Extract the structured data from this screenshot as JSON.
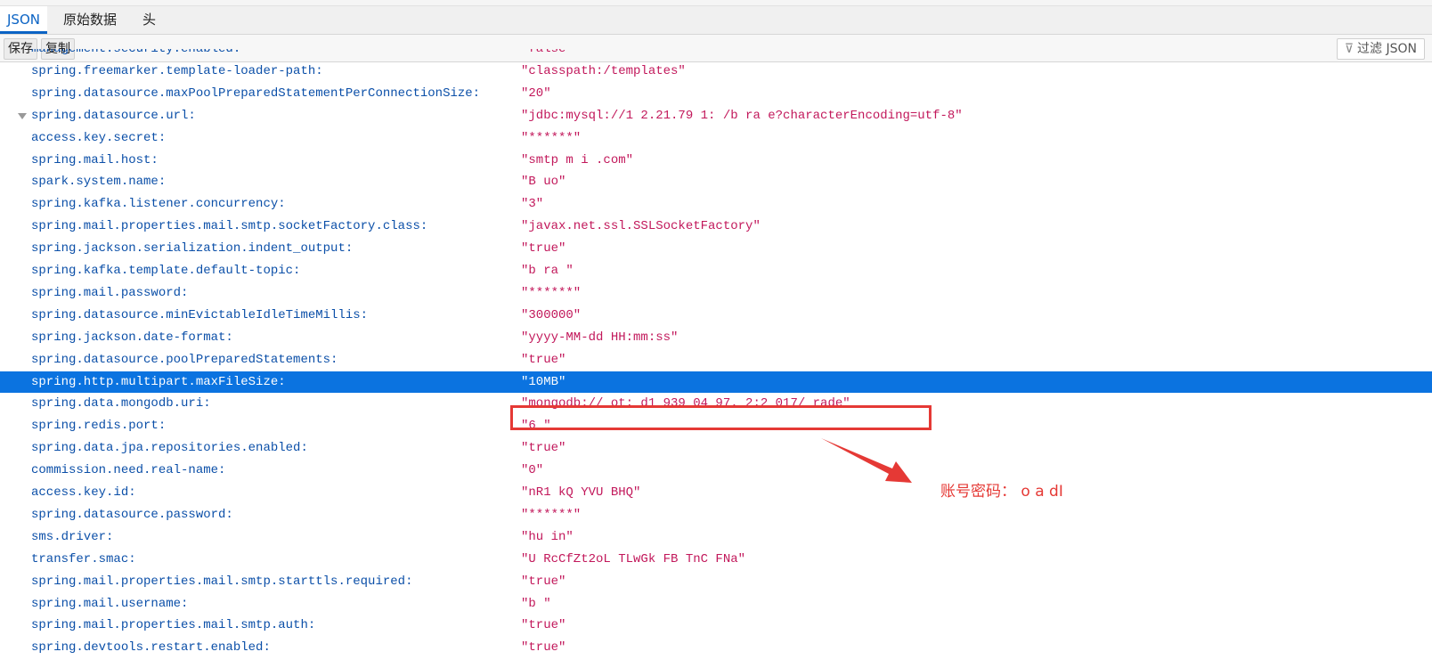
{
  "tabs": [
    {
      "label": "JSON",
      "active": true
    },
    {
      "label": "原始数据",
      "active": false
    },
    {
      "label": "头",
      "active": false
    }
  ],
  "toolbar": {
    "save_label": "保存",
    "copy_label": "复制",
    "filter_label": "过滤 JSON"
  },
  "rows": [
    {
      "key": "management.security.enabled:",
      "value": "\"false\""
    },
    {
      "key": "spring.freemarker.template-loader-path:",
      "value": "\"classpath:/templates\""
    },
    {
      "key": "spring.datasource.maxPoolPreparedStatementPerConnectionSize:",
      "value": "\"20\""
    },
    {
      "key": "spring.datasource.url:",
      "value": "\"jdbc:mysql://1 2.21.79 1:   /b  ra e?characterEncoding=utf-8\"",
      "expandable": true
    },
    {
      "key": "access.key.secret:",
      "value": "\"******\""
    },
    {
      "key": "spring.mail.host:",
      "value": "\"smtp  m  i .com\""
    },
    {
      "key": "spark.system.name:",
      "value": "\"B  uo\""
    },
    {
      "key": "spring.kafka.listener.concurrency:",
      "value": "\"3\""
    },
    {
      "key": "spring.mail.properties.mail.smtp.socketFactory.class:",
      "value": "\"javax.net.ssl.SSLSocketFactory\""
    },
    {
      "key": "spring.jackson.serialization.indent_output:",
      "value": "\"true\""
    },
    {
      "key": "spring.kafka.template.default-topic:",
      "value": "\"b  ra \""
    },
    {
      "key": "spring.mail.password:",
      "value": "\"******\""
    },
    {
      "key": "spring.datasource.minEvictableIdleTimeMillis:",
      "value": "\"300000\""
    },
    {
      "key": "spring.jackson.date-format:",
      "value": "\"yyyy-MM-dd HH:mm:ss\""
    },
    {
      "key": "spring.datasource.poolPreparedStatements:",
      "value": "\"true\""
    },
    {
      "key": "spring.http.multipart.maxFileSize:",
      "value": "\"10MB\"",
      "selected": true
    },
    {
      "key": "spring.data.mongodb.uri:",
      "value": "\"mongodb://  ot:  d1  939  04 97.  2:2 017/  rade\"",
      "highlighted": true
    },
    {
      "key": "spring.redis.port:",
      "value": "\"6  \""
    },
    {
      "key": "spring.data.jpa.repositories.enabled:",
      "value": "\"true\""
    },
    {
      "key": "commission.need.real-name:",
      "value": "\"0\""
    },
    {
      "key": "access.key.id:",
      "value": "\"nR1  kQ  YVU  BHQ\""
    },
    {
      "key": "spring.datasource.password:",
      "value": "\"******\""
    },
    {
      "key": "sms.driver:",
      "value": "\"hu  in\""
    },
    {
      "key": "transfer.smac:",
      "value": "\"U  RcCfZt2oL  TLwGk  FB  TnC  FNa\""
    },
    {
      "key": "spring.mail.properties.mail.smtp.starttls.required:",
      "value": "\"true\""
    },
    {
      "key": "spring.mail.username:",
      "value": "\"b    \""
    },
    {
      "key": "spring.mail.properties.mail.smtp.auth:",
      "value": "\"true\""
    },
    {
      "key": "spring.devtools.restart.enabled:",
      "value": "\"true\""
    }
  ],
  "annotation": {
    "text": "账号密码：  o  a  dI  ",
    "color": "#e53935"
  },
  "colors": {
    "key": "#0b4fa8",
    "value": "#c2185b",
    "selected": "#0b73e0",
    "accent": "#0b63c4"
  },
  "icons": {
    "filter": "filter-icon",
    "expand": "triangle-down-icon"
  }
}
